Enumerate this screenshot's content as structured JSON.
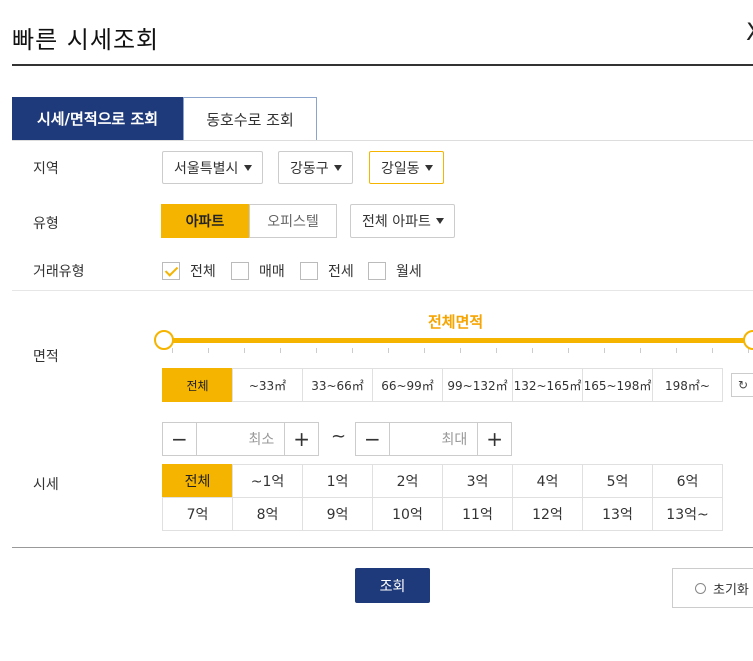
{
  "dialog": {
    "title": "빠른 시세조회",
    "close_glyph": "X"
  },
  "tabs": [
    {
      "label": "시세/면적으로 조회",
      "active": true
    },
    {
      "label": "동호수로 조회",
      "active": false
    }
  ],
  "region": {
    "label": "지역",
    "city": "서울특별시",
    "district": "강동구",
    "dong": "강일동"
  },
  "type": {
    "label": "유형",
    "options": [
      "아파트",
      "오피스텔"
    ],
    "selected": "아파트",
    "subtype": "전체 아파트"
  },
  "trade": {
    "label": "거래유형",
    "options": [
      {
        "label": "전체",
        "checked": true
      },
      {
        "label": "매매",
        "checked": false
      },
      {
        "label": "전세",
        "checked": false
      },
      {
        "label": "월세",
        "checked": false
      }
    ]
  },
  "area": {
    "label": "면적",
    "range_title": "전체면적",
    "slider": {
      "min": 0,
      "max": 1
    },
    "buttons": [
      "전체",
      "~33㎡",
      "33~66㎡",
      "66~99㎡",
      "99~132㎡",
      "132~165㎡",
      "165~198㎡",
      "198㎡~"
    ],
    "selected": "전체",
    "reset_glyph": "↻"
  },
  "price": {
    "label": "시세",
    "min_placeholder": "최소",
    "max_placeholder": "최대",
    "minus_glyph": "−",
    "plus_glyph": "+",
    "range_sep": "~",
    "buttons_row1": [
      "전체",
      "~1억",
      "1억",
      "2억",
      "3억",
      "4억",
      "5억",
      "6억"
    ],
    "buttons_row2": [
      "7억",
      "8억",
      "9억",
      "10억",
      "11억",
      "12억",
      "13억",
      "13억~"
    ],
    "selected": "전체"
  },
  "actions": {
    "search_label": "조회",
    "reset_label": "초기화"
  },
  "colors": {
    "navy": "#1f3a7a",
    "accent": "#f5b400"
  }
}
